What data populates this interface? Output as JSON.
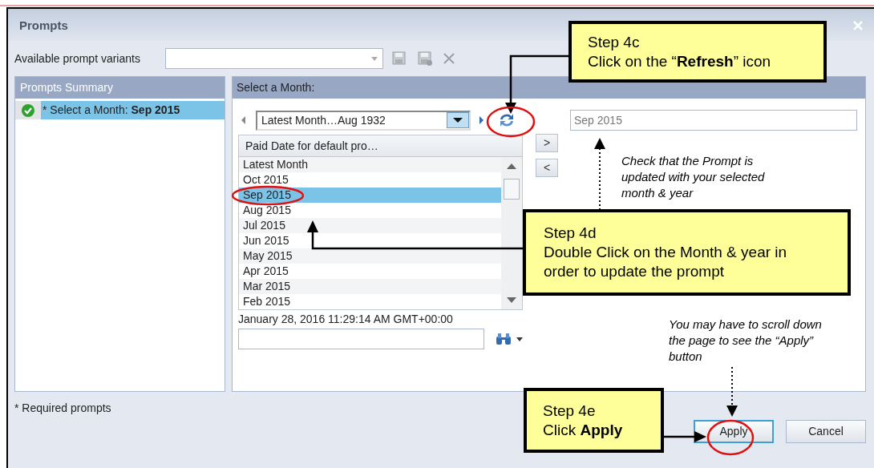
{
  "window": {
    "title": "Prompts"
  },
  "variants": {
    "label": "Available prompt variants"
  },
  "summary": {
    "header": "Prompts Summary",
    "items": [
      {
        "prefix": "* Select a Month: ",
        "value": "Sep 2015",
        "selected": true,
        "done": true
      }
    ]
  },
  "month_panel": {
    "header": "Select a Month:",
    "combo": "Latest Month…Aug 1932",
    "list_header": "Paid Date for default pro…",
    "rows": [
      {
        "label": "Latest Month",
        "selected": false
      },
      {
        "label": "Oct 2015",
        "selected": false
      },
      {
        "label": "Sep 2015",
        "selected": true
      },
      {
        "label": "Aug 2015",
        "selected": false
      },
      {
        "label": "Jul 2015",
        "selected": false
      },
      {
        "label": "Jun 2015",
        "selected": false
      },
      {
        "label": "May 2015",
        "selected": false
      },
      {
        "label": "Apr 2015",
        "selected": false
      },
      {
        "label": "Mar 2015",
        "selected": false
      },
      {
        "label": "Feb 2015",
        "selected": false
      }
    ],
    "add_button": ">",
    "remove_button": "<",
    "selected_value": "Sep 2015",
    "timestamp": "January 28, 2016 11:29:14 AM GMT+00:00"
  },
  "footer": {
    "note": "* Required prompts",
    "buttons": [
      "Apply",
      "Cancel"
    ]
  },
  "callouts": [
    {
      "title": "Step 4c",
      "text": "Click on the “**Refresh**” icon"
    },
    {
      "title": "Step 4d",
      "text": "Double Click on the Month & year in order to update the prompt"
    },
    {
      "title": "Step 4e",
      "text": "Click **Apply**"
    }
  ],
  "notes": [
    "Check that the Prompt is updated with your selected month & year",
    "You may have to scroll down the page to see the “Apply” button"
  ]
}
